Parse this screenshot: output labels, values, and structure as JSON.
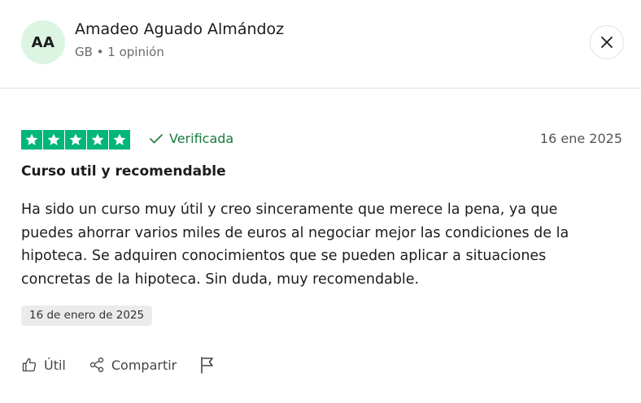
{
  "reviewer": {
    "initials": "AA",
    "name": "Amadeo Aguado Almándoz",
    "meta": "GB • 1 opinión"
  },
  "review": {
    "rating": 5,
    "verified_label": "Verificada",
    "date": "16 ene 2025",
    "title": "Curso util y recomendable",
    "body": "Ha sido un curso muy útil y creo sinceramente que merece la pena, ya que puedes ahorrar varios miles de euros al negociar mejor las condiciones de la hipoteca. Se adquiren conocimientos que se pueden aplicar a situaciones concretas de la hipoteca. Sin duda, muy recomendable.",
    "experience_date": "16 de enero de 2025"
  },
  "actions": {
    "useful_label": "Útil",
    "share_label": "Compartir"
  },
  "colors": {
    "star_green": "#00b67a",
    "verified_green": "#1a7a3c",
    "avatar_bg": "#dcf5e3"
  },
  "icons": [
    "close-icon",
    "star-icon",
    "check-icon",
    "thumbs-up-icon",
    "share-icon",
    "flag-icon"
  ]
}
